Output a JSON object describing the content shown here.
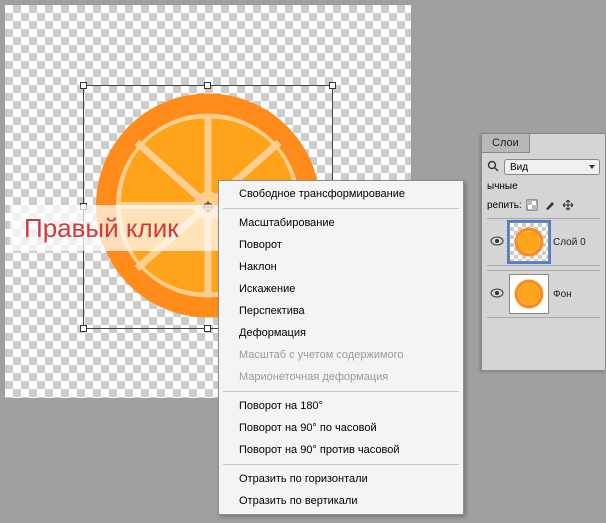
{
  "overlay_label": "Правый клик",
  "context_menu": {
    "groups": [
      [
        {
          "label": "Свободное трансформирование",
          "disabled": false
        }
      ],
      [
        {
          "label": "Масштабирование",
          "disabled": false
        },
        {
          "label": "Поворот",
          "disabled": false
        },
        {
          "label": "Наклон",
          "disabled": false
        },
        {
          "label": "Искажение",
          "disabled": false
        },
        {
          "label": "Перспектива",
          "disabled": false
        },
        {
          "label": "Деформация",
          "disabled": false
        },
        {
          "label": "Масштаб с учетом содержимого",
          "disabled": true
        },
        {
          "label": "Марионеточная деформация",
          "disabled": true
        }
      ],
      [
        {
          "label": "Поворот на 180°",
          "disabled": false
        },
        {
          "label": "Поворот на 90° по часовой",
          "disabled": false
        },
        {
          "label": "Поворот на 90° против часовой",
          "disabled": false
        }
      ],
      [
        {
          "label": "Отразить по горизонтали",
          "disabled": false
        },
        {
          "label": "Отразить по вертикали",
          "disabled": false
        }
      ]
    ]
  },
  "layers_panel": {
    "title": "Слои",
    "filter_value": "Вид",
    "row2_left": "ычные",
    "row3_left": "репить:",
    "layers": [
      {
        "name": "Слой 0",
        "selected": true,
        "transparent_bg": true
      },
      {
        "name": "Фон",
        "selected": false,
        "transparent_bg": false
      }
    ]
  }
}
